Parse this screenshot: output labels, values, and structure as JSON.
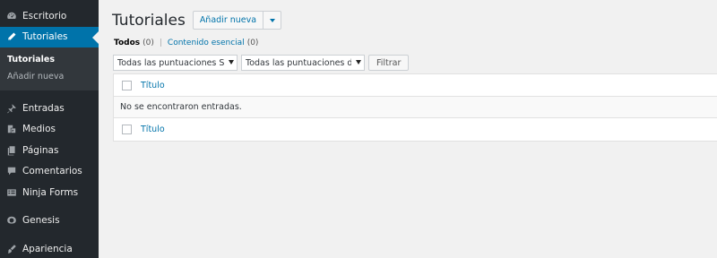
{
  "sidebar": {
    "items": [
      {
        "label": "Escritorio",
        "icon": "dashboard-icon"
      },
      {
        "label": "Tutoriales",
        "icon": "pencil-icon",
        "current": true
      },
      {
        "label": "Entradas",
        "icon": "pin-icon"
      },
      {
        "label": "Medios",
        "icon": "media-icon"
      },
      {
        "label": "Páginas",
        "icon": "pages-icon"
      },
      {
        "label": "Comentarios",
        "icon": "comment-icon"
      },
      {
        "label": "Ninja Forms",
        "icon": "forms-icon"
      },
      {
        "label": "Genesis",
        "icon": "genesis-icon"
      },
      {
        "label": "Apariencia",
        "icon": "brush-icon"
      }
    ],
    "submenu": [
      {
        "label": "Tutoriales",
        "active": true
      },
      {
        "label": "Añadir nueva",
        "active": false
      }
    ]
  },
  "header": {
    "title": "Tutoriales",
    "add_label": "Añadir nueva"
  },
  "views": {
    "all_label": "Todos",
    "all_count": "(0)",
    "separator": "|",
    "essential_label": "Contenido esencial",
    "essential_count": "(0)"
  },
  "filters": {
    "seo_select": "Todas las puntuaciones SEO",
    "readability_select": "Todas las puntuaciones de le",
    "filter_button": "Filtrar"
  },
  "table": {
    "column_title": "Título",
    "empty_message": "No se encontraron entradas.",
    "footer_title": "Título"
  },
  "colors": {
    "sidebar_bg": "#23282d",
    "accent": "#0073aa",
    "page_bg": "#f1f1f1"
  }
}
